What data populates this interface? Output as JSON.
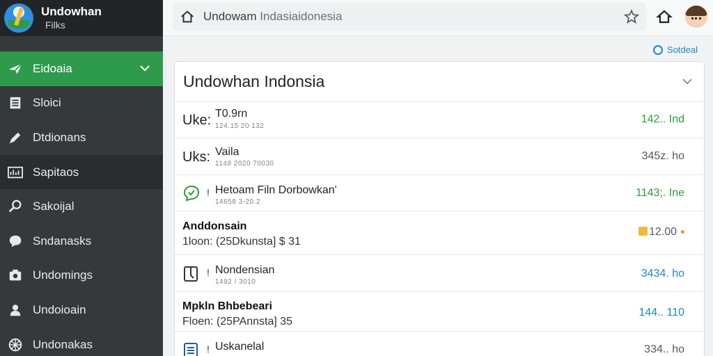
{
  "app": {
    "title": "Undowhan",
    "subtitle": "Filks"
  },
  "sidebar": {
    "items": [
      {
        "label": "Eidoaia",
        "icon": "paper-plane-icon",
        "active": true
      },
      {
        "label": "Sloici",
        "icon": "document-icon"
      },
      {
        "label": "Dtdionans",
        "icon": "pen-icon"
      },
      {
        "label": "Sapitaos",
        "icon": "chart-icon"
      },
      {
        "label": "Sakoijal",
        "icon": "search-icon"
      },
      {
        "label": "Sndanasks",
        "icon": "chat-icon"
      },
      {
        "label": "Undomings",
        "icon": "camera-icon"
      },
      {
        "label": "Undoioain",
        "icon": "user-icon"
      },
      {
        "label": "Undonakas",
        "icon": "settings-icon"
      }
    ]
  },
  "topbar": {
    "url_main": "Undowam",
    "url_rest": " Indasiaidonesia"
  },
  "content": {
    "link_text": "Sotdeal",
    "card": {
      "title": "Undowhan Indonsia",
      "rows": [
        {
          "lead": "Uke:",
          "name": "T0.9rn",
          "sub": "124.15 20 132",
          "amount": "142.. Ind",
          "color": "green"
        },
        {
          "lead": "Uks:",
          "name": "Vaila",
          "sub": "1148 2020 70030",
          "amount": "345z. ho",
          "color": "gray"
        },
        {
          "tick": "!",
          "name": "Hetoam Filn Dorbowkan'",
          "sub": "14658 3-20.2",
          "amount": "1143;. Ine",
          "color": "green"
        },
        {
          "bold": "Anddonsain",
          "subline": "1loon: (25Dkunsta] $ 31",
          "amount": "12.00",
          "color": "gray"
        },
        {
          "tick": "!",
          "name": "Nondensian",
          "sub": "1492 / 3010",
          "amount": "3434. ho",
          "color": "blue"
        },
        {
          "bold": "Mpkln Bhbebeari",
          "subline": "Floen: (25PAnnsta] 35",
          "amount": "144.. 110",
          "color": "blue"
        },
        {
          "tick": "!",
          "name": "Uskanelal",
          "sub": "",
          "amount": "334.. ho",
          "color": "gray"
        }
      ]
    }
  }
}
